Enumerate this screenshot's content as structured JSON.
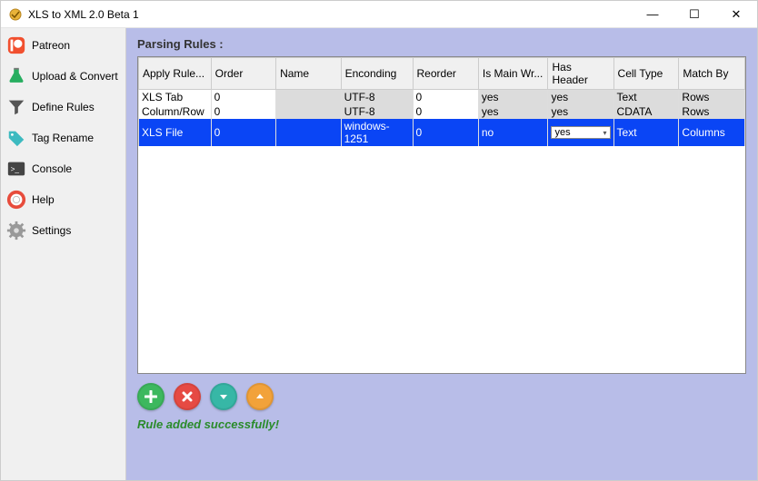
{
  "window": {
    "title": "XLS to XML 2.0 Beta 1"
  },
  "titlebar": {
    "min": "—",
    "max": "☐",
    "close": "✕"
  },
  "sidebar": {
    "items": [
      {
        "label": "Patreon"
      },
      {
        "label": "Upload & Convert"
      },
      {
        "label": "Define Rules"
      },
      {
        "label": "Tag Rename"
      },
      {
        "label": "Console"
      },
      {
        "label": "Help"
      },
      {
        "label": "Settings"
      }
    ]
  },
  "content": {
    "title": "Parsing Rules :",
    "columns": [
      "Apply Rule...",
      "Order",
      "Name",
      "Enconding",
      "Reorder",
      "Is Main Wr...",
      "Has Header",
      "Cell Type",
      "Match By"
    ],
    "rows": [
      {
        "apply": "XLS Tab",
        "order": "0",
        "name": "",
        "enc": "UTF-8",
        "reorder": "0",
        "main": "yes",
        "hh": "yes",
        "ct": "Text",
        "mb": "Rows",
        "selected": false
      },
      {
        "apply": "Column/Row",
        "order": "0",
        "name": "",
        "enc": "UTF-8",
        "reorder": "0",
        "main": "yes",
        "hh": "yes",
        "ct": "CDATA",
        "mb": "Rows",
        "selected": false
      },
      {
        "apply": "XLS File",
        "order": "0",
        "name": "",
        "enc": "windows-1251",
        "reorder": "0",
        "main": "no",
        "hh": "yes",
        "ct": "Text",
        "mb": "Columns",
        "selected": true
      }
    ],
    "status": "Rule added successfully!"
  }
}
